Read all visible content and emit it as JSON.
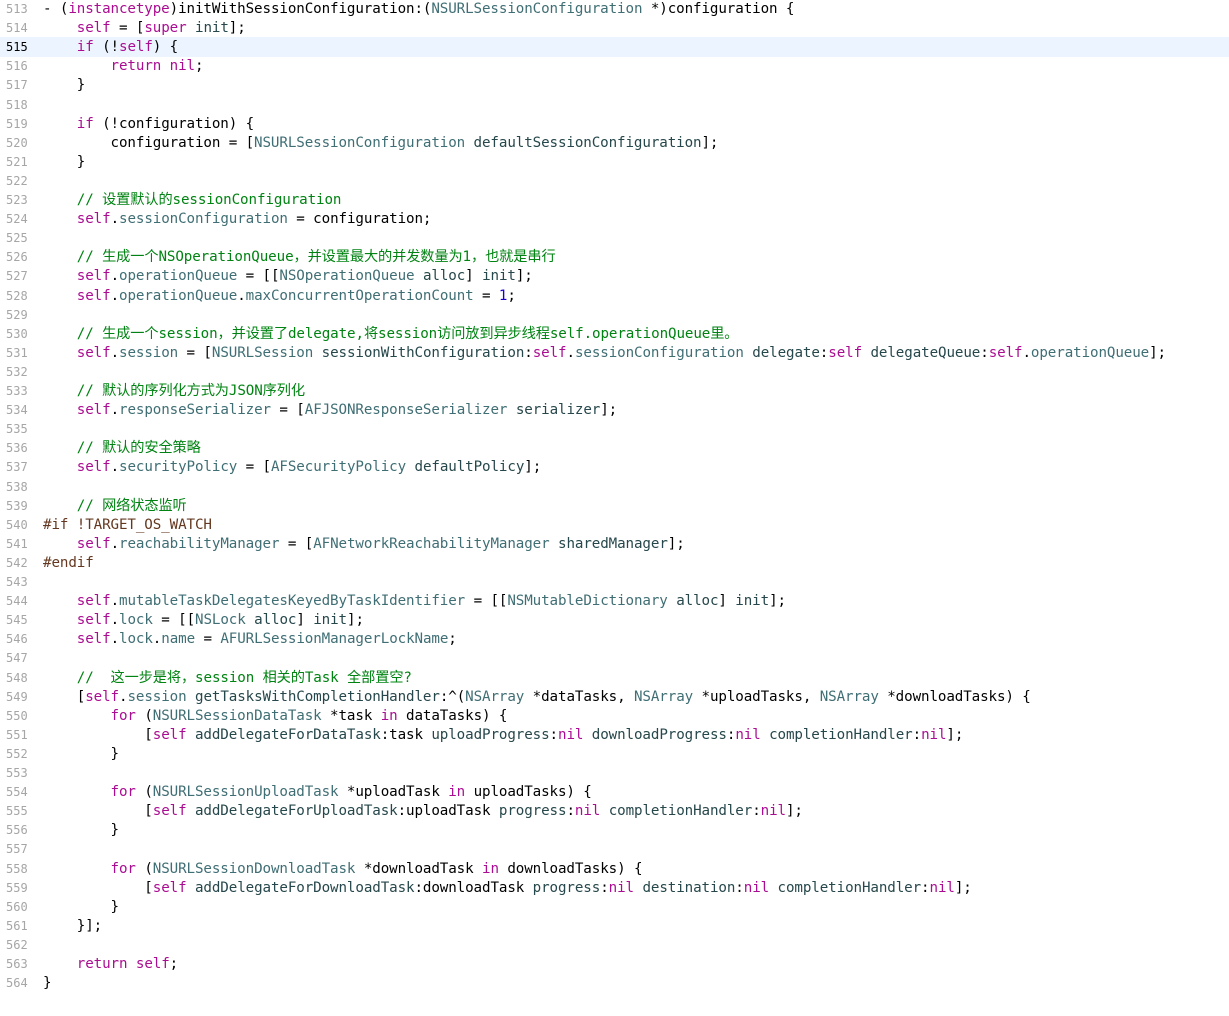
{
  "editor": {
    "current_line": 515,
    "colors": {
      "keyword": "#aa0d91",
      "class": "#3f6e74",
      "method": "#26474b",
      "comment": "#008312",
      "preprocessor": "#643820",
      "number": "#1c00cf",
      "plain": "#000000",
      "line_number": "#a6a6a6",
      "current_line_bg": "#ecf5ff"
    },
    "lines": [
      {
        "n": "513",
        "tokens": [
          [
            "p",
            "- ("
          ],
          [
            "k",
            "instancetype"
          ],
          [
            "p",
            ")initWithSessionConfiguration:("
          ],
          [
            "c",
            "NSURLSessionConfiguration"
          ],
          [
            "p",
            " *)configuration {"
          ]
        ]
      },
      {
        "n": "514",
        "tokens": [
          [
            "p",
            "    "
          ],
          [
            "k",
            "self"
          ],
          [
            "p",
            " = ["
          ],
          [
            "k",
            "super"
          ],
          [
            "p",
            " "
          ],
          [
            "m",
            "init"
          ],
          [
            "p",
            "];"
          ]
        ]
      },
      {
        "n": "515",
        "tokens": [
          [
            "p",
            "    "
          ],
          [
            "k",
            "if"
          ],
          [
            "p",
            " (!"
          ],
          [
            "k",
            "self"
          ],
          [
            "p",
            ") {"
          ]
        ]
      },
      {
        "n": "516",
        "tokens": [
          [
            "p",
            "        "
          ],
          [
            "k",
            "return"
          ],
          [
            "p",
            " "
          ],
          [
            "k",
            "nil"
          ],
          [
            "p",
            ";"
          ]
        ]
      },
      {
        "n": "517",
        "tokens": [
          [
            "p",
            "    }"
          ]
        ]
      },
      {
        "n": "518",
        "tokens": []
      },
      {
        "n": "519",
        "tokens": [
          [
            "p",
            "    "
          ],
          [
            "k",
            "if"
          ],
          [
            "p",
            " (!configuration) {"
          ]
        ]
      },
      {
        "n": "520",
        "tokens": [
          [
            "p",
            "        configuration = ["
          ],
          [
            "c",
            "NSURLSessionConfiguration"
          ],
          [
            "p",
            " "
          ],
          [
            "m",
            "defaultSessionConfiguration"
          ],
          [
            "p",
            "];"
          ]
        ]
      },
      {
        "n": "521",
        "tokens": [
          [
            "p",
            "    }"
          ]
        ]
      },
      {
        "n": "522",
        "tokens": []
      },
      {
        "n": "523",
        "tokens": [
          [
            "t",
            "    // 设置默认的sessionConfiguration"
          ]
        ]
      },
      {
        "n": "524",
        "tokens": [
          [
            "p",
            "    "
          ],
          [
            "k",
            "self"
          ],
          [
            "p",
            "."
          ],
          [
            "r",
            "sessionConfiguration"
          ],
          [
            "p",
            " = configuration;"
          ]
        ]
      },
      {
        "n": "525",
        "tokens": []
      },
      {
        "n": "526",
        "tokens": [
          [
            "t",
            "    // 生成一个NSOperationQueue，并设置最大的并发数量为1，也就是串行"
          ]
        ]
      },
      {
        "n": "527",
        "tokens": [
          [
            "p",
            "    "
          ],
          [
            "k",
            "self"
          ],
          [
            "p",
            "."
          ],
          [
            "r",
            "operationQueue"
          ],
          [
            "p",
            " = [["
          ],
          [
            "c",
            "NSOperationQueue"
          ],
          [
            "p",
            " "
          ],
          [
            "m",
            "alloc"
          ],
          [
            "p",
            "] "
          ],
          [
            "m",
            "init"
          ],
          [
            "p",
            "];"
          ]
        ]
      },
      {
        "n": "528",
        "tokens": [
          [
            "p",
            "    "
          ],
          [
            "k",
            "self"
          ],
          [
            "p",
            "."
          ],
          [
            "r",
            "operationQueue"
          ],
          [
            "p",
            "."
          ],
          [
            "r",
            "maxConcurrentOperationCount"
          ],
          [
            "p",
            " = "
          ],
          [
            "u",
            "1"
          ],
          [
            "p",
            ";"
          ]
        ]
      },
      {
        "n": "529",
        "tokens": []
      },
      {
        "n": "530",
        "tokens": [
          [
            "t",
            "    // 生成一个session，并设置了delegate,将session访问放到异步线程self.operationQueue里。"
          ]
        ]
      },
      {
        "n": "531",
        "tokens": [
          [
            "p",
            "    "
          ],
          [
            "k",
            "self"
          ],
          [
            "p",
            "."
          ],
          [
            "r",
            "session"
          ],
          [
            "p",
            " = ["
          ],
          [
            "c",
            "NSURLSession"
          ],
          [
            "p",
            " "
          ],
          [
            "m",
            "sessionWithConfiguration"
          ],
          [
            "p",
            ":"
          ],
          [
            "k",
            "self"
          ],
          [
            "p",
            "."
          ],
          [
            "r",
            "sessionConfiguration"
          ],
          [
            "p",
            " "
          ],
          [
            "m",
            "delegate"
          ],
          [
            "p",
            ":"
          ],
          [
            "k",
            "self"
          ],
          [
            "p",
            " "
          ],
          [
            "m",
            "delegateQueue"
          ],
          [
            "p",
            ":"
          ],
          [
            "k",
            "self"
          ],
          [
            "p",
            "."
          ],
          [
            "r",
            "operationQueue"
          ],
          [
            "p",
            "];"
          ]
        ]
      },
      {
        "n": "532",
        "tokens": []
      },
      {
        "n": "533",
        "tokens": [
          [
            "t",
            "    // 默认的序列化方式为JSON序列化"
          ]
        ]
      },
      {
        "n": "534",
        "tokens": [
          [
            "p",
            "    "
          ],
          [
            "k",
            "self"
          ],
          [
            "p",
            "."
          ],
          [
            "r",
            "responseSerializer"
          ],
          [
            "p",
            " = ["
          ],
          [
            "c",
            "AFJSONResponseSerializer"
          ],
          [
            "p",
            " "
          ],
          [
            "m",
            "serializer"
          ],
          [
            "p",
            "];"
          ]
        ]
      },
      {
        "n": "535",
        "tokens": []
      },
      {
        "n": "536",
        "tokens": [
          [
            "t",
            "    // 默认的安全策略"
          ]
        ]
      },
      {
        "n": "537",
        "tokens": [
          [
            "p",
            "    "
          ],
          [
            "k",
            "self"
          ],
          [
            "p",
            "."
          ],
          [
            "r",
            "securityPolicy"
          ],
          [
            "p",
            " = ["
          ],
          [
            "c",
            "AFSecurityPolicy"
          ],
          [
            "p",
            " "
          ],
          [
            "m",
            "defaultPolicy"
          ],
          [
            "p",
            "];"
          ]
        ]
      },
      {
        "n": "538",
        "tokens": []
      },
      {
        "n": "539",
        "tokens": [
          [
            "t",
            "    // 网络状态监听"
          ]
        ]
      },
      {
        "n": "540",
        "tokens": [
          [
            "x",
            "#if !TARGET_OS_WATCH"
          ]
        ]
      },
      {
        "n": "541",
        "tokens": [
          [
            "p",
            "    "
          ],
          [
            "k",
            "self"
          ],
          [
            "p",
            "."
          ],
          [
            "r",
            "reachabilityManager"
          ],
          [
            "p",
            " = ["
          ],
          [
            "c",
            "AFNetworkReachabilityManager"
          ],
          [
            "p",
            " "
          ],
          [
            "m",
            "sharedManager"
          ],
          [
            "p",
            "];"
          ]
        ]
      },
      {
        "n": "542",
        "tokens": [
          [
            "x",
            "#endif"
          ]
        ]
      },
      {
        "n": "543",
        "tokens": []
      },
      {
        "n": "544",
        "tokens": [
          [
            "p",
            "    "
          ],
          [
            "k",
            "self"
          ],
          [
            "p",
            "."
          ],
          [
            "r",
            "mutableTaskDelegatesKeyedByTaskIdentifier"
          ],
          [
            "p",
            " = [["
          ],
          [
            "c",
            "NSMutableDictionary"
          ],
          [
            "p",
            " "
          ],
          [
            "m",
            "alloc"
          ],
          [
            "p",
            "] "
          ],
          [
            "m",
            "init"
          ],
          [
            "p",
            "];"
          ]
        ]
      },
      {
        "n": "545",
        "tokens": [
          [
            "p",
            "    "
          ],
          [
            "k",
            "self"
          ],
          [
            "p",
            "."
          ],
          [
            "r",
            "lock"
          ],
          [
            "p",
            " = [["
          ],
          [
            "c",
            "NSLock"
          ],
          [
            "p",
            " "
          ],
          [
            "m",
            "alloc"
          ],
          [
            "p",
            "] "
          ],
          [
            "m",
            "init"
          ],
          [
            "p",
            "];"
          ]
        ]
      },
      {
        "n": "546",
        "tokens": [
          [
            "p",
            "    "
          ],
          [
            "k",
            "self"
          ],
          [
            "p",
            "."
          ],
          [
            "r",
            "lock"
          ],
          [
            "p",
            "."
          ],
          [
            "r",
            "name"
          ],
          [
            "p",
            " = "
          ],
          [
            "c",
            "AFURLSessionManagerLockName"
          ],
          [
            "p",
            ";"
          ]
        ]
      },
      {
        "n": "547",
        "tokens": []
      },
      {
        "n": "548",
        "tokens": [
          [
            "t",
            "    //  这一步是将，session 相关的Task 全部置空?"
          ]
        ]
      },
      {
        "n": "549",
        "tokens": [
          [
            "p",
            "    ["
          ],
          [
            "k",
            "self"
          ],
          [
            "p",
            "."
          ],
          [
            "r",
            "session"
          ],
          [
            "p",
            " "
          ],
          [
            "m",
            "getTasksWithCompletionHandler"
          ],
          [
            "p",
            ":^("
          ],
          [
            "c",
            "NSArray"
          ],
          [
            "p",
            " *dataTasks, "
          ],
          [
            "c",
            "NSArray"
          ],
          [
            "p",
            " *uploadTasks, "
          ],
          [
            "c",
            "NSArray"
          ],
          [
            "p",
            " *downloadTasks) {"
          ]
        ]
      },
      {
        "n": "550",
        "tokens": [
          [
            "p",
            "        "
          ],
          [
            "k",
            "for"
          ],
          [
            "p",
            " ("
          ],
          [
            "c",
            "NSURLSessionDataTask"
          ],
          [
            "p",
            " *task "
          ],
          [
            "k",
            "in"
          ],
          [
            "p",
            " dataTasks) {"
          ]
        ]
      },
      {
        "n": "551",
        "tokens": [
          [
            "p",
            "            ["
          ],
          [
            "k",
            "self"
          ],
          [
            "p",
            " "
          ],
          [
            "m",
            "addDelegateForDataTask"
          ],
          [
            "p",
            ":task "
          ],
          [
            "m",
            "uploadProgress"
          ],
          [
            "p",
            ":"
          ],
          [
            "k",
            "nil"
          ],
          [
            "p",
            " "
          ],
          [
            "m",
            "downloadProgress"
          ],
          [
            "p",
            ":"
          ],
          [
            "k",
            "nil"
          ],
          [
            "p",
            " "
          ],
          [
            "m",
            "completionHandler"
          ],
          [
            "p",
            ":"
          ],
          [
            "k",
            "nil"
          ],
          [
            "p",
            "];"
          ]
        ]
      },
      {
        "n": "552",
        "tokens": [
          [
            "p",
            "        }"
          ]
        ]
      },
      {
        "n": "553",
        "tokens": []
      },
      {
        "n": "554",
        "tokens": [
          [
            "p",
            "        "
          ],
          [
            "k",
            "for"
          ],
          [
            "p",
            " ("
          ],
          [
            "c",
            "NSURLSessionUploadTask"
          ],
          [
            "p",
            " *uploadTask "
          ],
          [
            "k",
            "in"
          ],
          [
            "p",
            " uploadTasks) {"
          ]
        ]
      },
      {
        "n": "555",
        "tokens": [
          [
            "p",
            "            ["
          ],
          [
            "k",
            "self"
          ],
          [
            "p",
            " "
          ],
          [
            "m",
            "addDelegateForUploadTask"
          ],
          [
            "p",
            ":uploadTask "
          ],
          [
            "m",
            "progress"
          ],
          [
            "p",
            ":"
          ],
          [
            "k",
            "nil"
          ],
          [
            "p",
            " "
          ],
          [
            "m",
            "completionHandler"
          ],
          [
            "p",
            ":"
          ],
          [
            "k",
            "nil"
          ],
          [
            "p",
            "];"
          ]
        ]
      },
      {
        "n": "556",
        "tokens": [
          [
            "p",
            "        }"
          ]
        ]
      },
      {
        "n": "557",
        "tokens": []
      },
      {
        "n": "558",
        "tokens": [
          [
            "p",
            "        "
          ],
          [
            "k",
            "for"
          ],
          [
            "p",
            " ("
          ],
          [
            "c",
            "NSURLSessionDownloadTask"
          ],
          [
            "p",
            " *downloadTask "
          ],
          [
            "k",
            "in"
          ],
          [
            "p",
            " downloadTasks) {"
          ]
        ]
      },
      {
        "n": "559",
        "tokens": [
          [
            "p",
            "            ["
          ],
          [
            "k",
            "self"
          ],
          [
            "p",
            " "
          ],
          [
            "m",
            "addDelegateForDownloadTask"
          ],
          [
            "p",
            ":downloadTask "
          ],
          [
            "m",
            "progress"
          ],
          [
            "p",
            ":"
          ],
          [
            "k",
            "nil"
          ],
          [
            "p",
            " "
          ],
          [
            "m",
            "destination"
          ],
          [
            "p",
            ":"
          ],
          [
            "k",
            "nil"
          ],
          [
            "p",
            " "
          ],
          [
            "m",
            "completionHandler"
          ],
          [
            "p",
            ":"
          ],
          [
            "k",
            "nil"
          ],
          [
            "p",
            "];"
          ]
        ]
      },
      {
        "n": "560",
        "tokens": [
          [
            "p",
            "        }"
          ]
        ]
      },
      {
        "n": "561",
        "tokens": [
          [
            "p",
            "    }];"
          ]
        ]
      },
      {
        "n": "562",
        "tokens": []
      },
      {
        "n": "563",
        "tokens": [
          [
            "p",
            "    "
          ],
          [
            "k",
            "return"
          ],
          [
            "p",
            " "
          ],
          [
            "k",
            "self"
          ],
          [
            "p",
            ";"
          ]
        ]
      },
      {
        "n": "564",
        "tokens": [
          [
            "p",
            "}"
          ]
        ]
      }
    ]
  }
}
